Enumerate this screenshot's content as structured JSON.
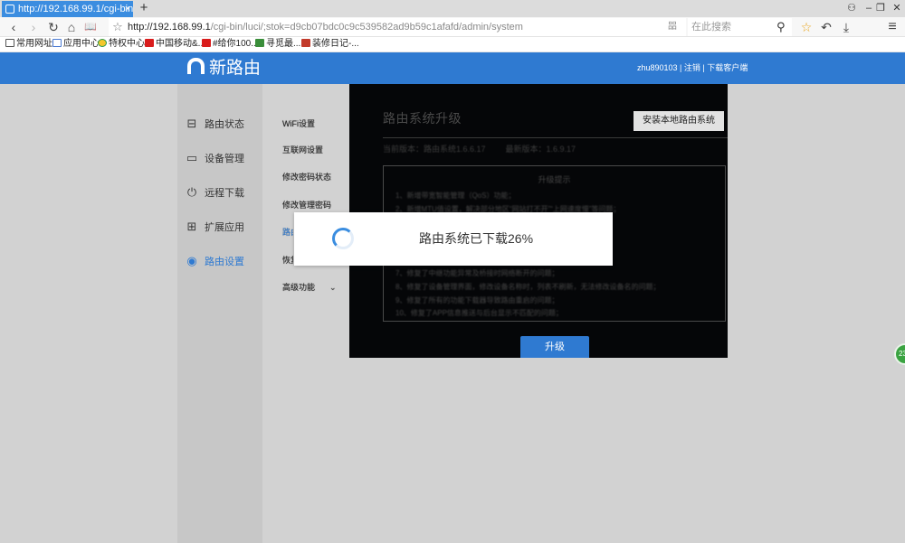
{
  "browser": {
    "tab_title": "http://192.168.99.1/cgi-bin/l",
    "tab_close": "×",
    "new_tab": "+",
    "window_controls": {
      "user": "⚇",
      "minimize": "–",
      "restore": "❐",
      "close": "✕"
    },
    "nav": {
      "back": "‹",
      "forward": "›",
      "reload": "↻",
      "home": "⌂",
      "reader": "📖"
    },
    "url_host": "http://192.168.99.1",
    "url_rest": "/cgi-bin/luci/;stok=d9cb07bdc0c9c539582ad9b59c1afafd/admin/system",
    "url_action": "㗊",
    "search_placeholder": "在此搜索",
    "search_go": "⚲",
    "toolbar_icons": {
      "favorite": "☆",
      "undo": "↶",
      "download": "⤓",
      "menu": "≡"
    },
    "bookmarks": [
      {
        "label": "常用网址",
        "icon": "folder-icon"
      },
      {
        "label": "应用中心",
        "icon": "cube-icon"
      },
      {
        "label": "特权中心",
        "icon": "chrome-icon"
      },
      {
        "label": "中国移动&...",
        "icon": "jd-icon"
      },
      {
        "label": "#给你100...",
        "icon": "jd-icon"
      },
      {
        "label": "寻觅最...",
        "icon": "leaf-icon"
      },
      {
        "label": "装修日记-...",
        "icon": "stamp-icon"
      }
    ]
  },
  "header": {
    "logo_text": "新路由",
    "user_links": "zhu890103 | 注销 | 下载客户端"
  },
  "left_nav": [
    {
      "label": "路由状态",
      "icon": "router-icon",
      "active": false
    },
    {
      "label": "设备管理",
      "icon": "monitor-icon",
      "active": false
    },
    {
      "label": "远程下载",
      "icon": "power-download-icon",
      "active": false
    },
    {
      "label": "扩展应用",
      "icon": "grid-icon",
      "active": false
    },
    {
      "label": "路由设置",
      "icon": "settings-circle-icon",
      "active": true
    }
  ],
  "sub_nav": [
    {
      "label": "WiFi设置"
    },
    {
      "label": "互联网设置"
    },
    {
      "label": "修改密码状态"
    },
    {
      "label": "修改管理密码"
    },
    {
      "label": "路由"
    },
    {
      "label": "恢复"
    },
    {
      "label": "高级功能",
      "arrow": "⌄"
    }
  ],
  "content": {
    "title": "路由系统升级",
    "install_button": "安装本地路由系统",
    "current_version": "当前版本：路由系统1.6.6.17",
    "latest_version": "最新版本：1.6.9.17",
    "notes_title": "升级提示",
    "notes": [
      "1、新增带宽智能管理（QoS）功能；",
      "2、新增MTU值设置，解决部分地区“网站打不开”“上网速度慢”等问题；",
      "7、修复了中继功能异常及桥接时网络断开的问题；",
      "8、修复了设备管理界面，修改设备名称时，列表不刷新，无法修改设备名的问题；",
      "9、修复了所有的功能下载器导致路由重启的问题；",
      "10、修复了APP信息推送与后台显示不匹配的问题；"
    ],
    "upgrade_button": "升级"
  },
  "dialog": {
    "message": "路由系统已下载26%",
    "progress_percent": 26
  },
  "side_float": {
    "label": "23"
  }
}
